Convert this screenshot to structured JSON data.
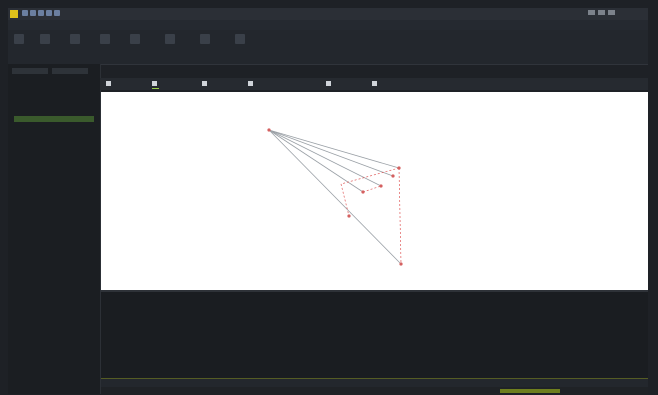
{
  "app": {
    "title": "",
    "brand_color": "#e0c21b",
    "accent": "#9bd14a"
  },
  "menu": {
    "items": [
      "",
      "",
      "",
      "",
      "",
      "",
      "",
      ""
    ]
  },
  "ribbon": {
    "buttons": [
      "",
      "",
      "",
      "",
      "",
      "",
      "",
      "",
      "",
      ""
    ]
  },
  "sidebar": {
    "items": [
      "",
      "",
      "",
      "",
      "",
      "",
      "",
      ""
    ]
  },
  "tabs": [
    {
      "label": ""
    },
    {
      "label": ""
    },
    {
      "label": ""
    },
    {
      "label": ""
    },
    {
      "label": ""
    },
    {
      "label": ""
    }
  ],
  "console": {
    "title": "",
    "lines": [
      "",
      "",
      "",
      "",
      "",
      ""
    ],
    "command": ""
  },
  "status": {
    "text": ""
  }
}
